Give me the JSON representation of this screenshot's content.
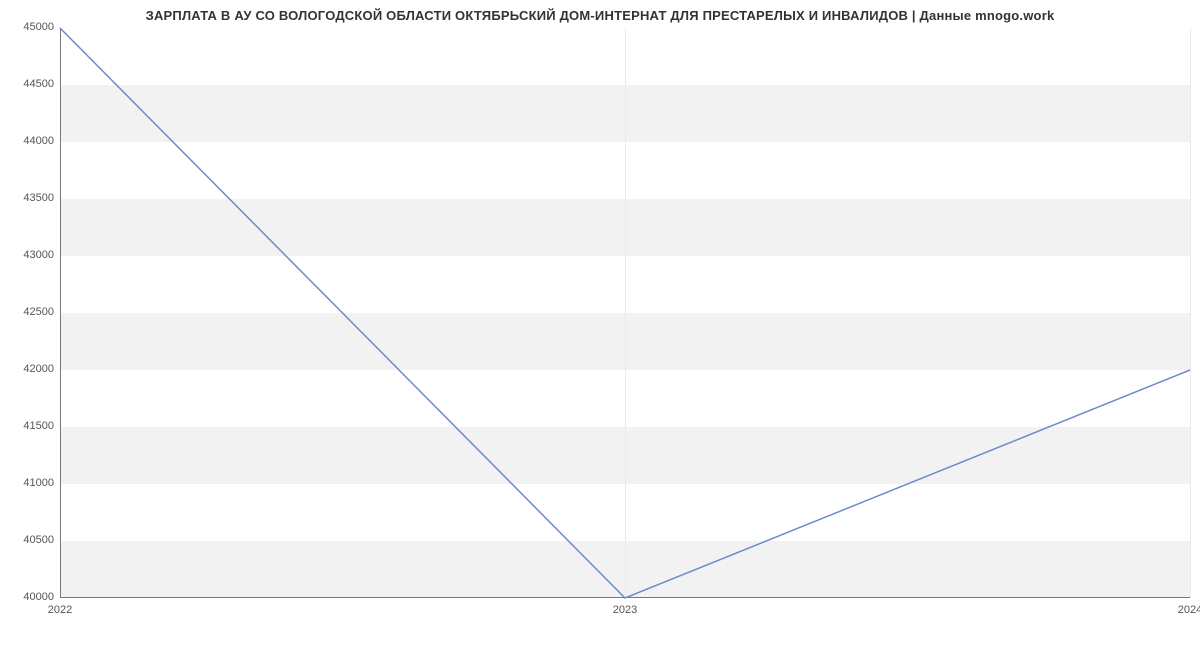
{
  "chart_data": {
    "type": "line",
    "title": "ЗАРПЛАТА В АУ СО ВОЛОГОДСКОЙ ОБЛАСТИ ОКТЯБРЬСКИЙ ДОМ-ИНТЕРНАТ ДЛЯ ПРЕСТАРЕЛЫХ И ИНВАЛИДОВ | Данные mnogo.work",
    "x": [
      "2022",
      "2023",
      "2024"
    ],
    "values": [
      45000,
      40000,
      42000
    ],
    "xlabel": "",
    "ylabel": "",
    "ylim": [
      40000,
      45000
    ],
    "y_ticks": [
      40000,
      40500,
      41000,
      41500,
      42000,
      42500,
      43000,
      43500,
      44000,
      44500,
      45000
    ],
    "x_ticks": [
      "2022",
      "2023",
      "2024"
    ],
    "line_color": "#6b8cc9",
    "band_color": "#f2f2f2"
  }
}
